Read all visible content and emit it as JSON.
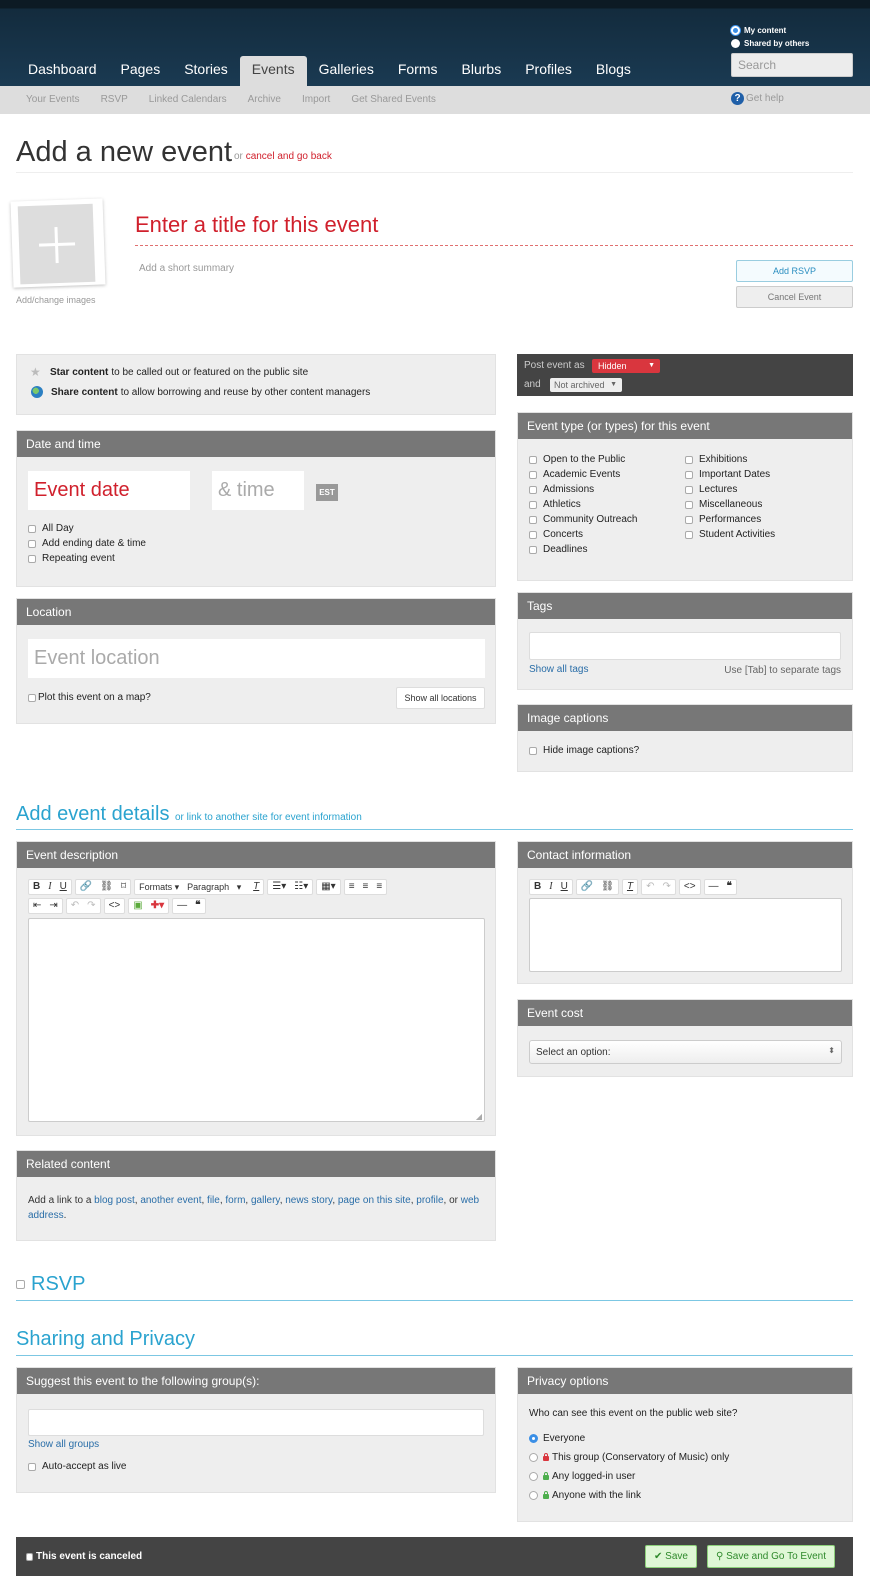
{
  "nav": {
    "tabs": [
      "Dashboard",
      "Pages",
      "Stories",
      "Events",
      "Galleries",
      "Forms",
      "Blurbs",
      "Profiles",
      "Blogs"
    ],
    "active": "Events",
    "scope_options": [
      {
        "label": "My content",
        "selected": true
      },
      {
        "label": "Shared by others",
        "selected": false
      }
    ],
    "search_placeholder": "Search"
  },
  "subnav": {
    "items": [
      "Your Events",
      "RSVP",
      "Linked Calendars",
      "Archive",
      "Import",
      "Get Shared Events"
    ],
    "help": "Get help"
  },
  "header": {
    "title": "Add a new event",
    "or": "or",
    "cancel_link": "cancel and go back"
  },
  "event": {
    "image_label": "Add/change images",
    "title_placeholder": "Enter a title for this event",
    "summary_placeholder": "Add a short summary",
    "add_rsvp": "Add RSVP",
    "cancel_event": "Cancel Event"
  },
  "feature": {
    "star_bold": "Star content",
    "star_text": "to be called out or featured on the public site",
    "share_bold": "Share content",
    "share_text": "to allow borrowing and reuse by other content managers"
  },
  "post": {
    "label": "Post event as",
    "status": "Hidden",
    "and": "and",
    "archive": "Not archived",
    "status_color": "#d9363e"
  },
  "date": {
    "heading": "Date and time",
    "date_placeholder": "Event date",
    "time_placeholder": "& time",
    "tz": "EST",
    "options": [
      "All Day",
      "Add ending date & time",
      "Repeating event"
    ]
  },
  "types": {
    "heading": "Event type (or types) for this event",
    "col1": [
      "Open to the Public",
      "Academic Events",
      "Admissions",
      "Athletics",
      "Community Outreach",
      "Concerts",
      "Deadlines"
    ],
    "col2": [
      "Exhibitions",
      "Important Dates",
      "Lectures",
      "Miscellaneous",
      "Performances",
      "Student Activities"
    ]
  },
  "location": {
    "heading": "Location",
    "placeholder": "Event location",
    "plot": "Plot this event on a map?",
    "show_all": "Show all locations"
  },
  "tags": {
    "heading": "Tags",
    "show_all": "Show all tags",
    "hint": "Use [Tab] to separate tags"
  },
  "captions": {
    "heading": "Image captions",
    "hide": "Hide image captions?"
  },
  "details": {
    "heading": "Add event details",
    "link": "or link to another site for event information",
    "description_heading": "Event description",
    "formats": "Formats",
    "paragraph": "Paragraph",
    "contact_heading": "Contact information",
    "cost_heading": "Event cost",
    "cost_select": "Select an option:"
  },
  "related": {
    "heading": "Related content",
    "prefix": "Add a link to a",
    "links": [
      "blog post",
      "another event",
      "file",
      "form",
      "gallery",
      "news story",
      "page on this site",
      "profile"
    ],
    "or": "or",
    "last": "web address"
  },
  "rsvp": {
    "heading": "RSVP"
  },
  "sharing": {
    "heading": "Sharing and Privacy",
    "suggest_heading": "Suggest this event to the following group(s):",
    "show_groups": "Show all groups",
    "auto_accept": "Auto-accept as live",
    "privacy_heading": "Privacy options",
    "privacy_question": "Who can see this event on the public web site?",
    "privacy_options": [
      {
        "label": "Everyone",
        "selected": true,
        "lock": ""
      },
      {
        "label": "This group (Conservatory of Music) only",
        "selected": false,
        "lock": "red"
      },
      {
        "label": "Any logged-in user",
        "selected": false,
        "lock": "green"
      },
      {
        "label": "Anyone with the link",
        "selected": false,
        "lock": "green"
      }
    ]
  },
  "footer": {
    "canceled": "This event is canceled",
    "save": "Save",
    "save_go": "Save and Go To Event"
  }
}
